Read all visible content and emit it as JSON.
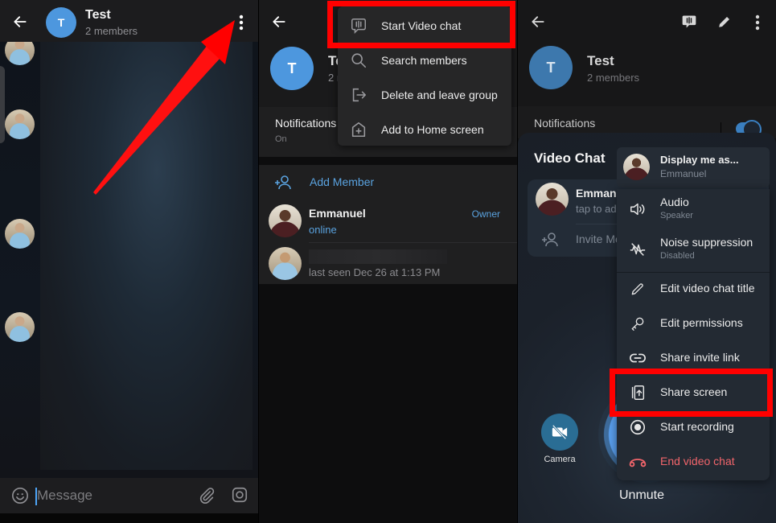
{
  "panel1": {
    "header": {
      "avatar_letter": "T",
      "title": "Test",
      "subtitle": "2 members"
    },
    "composer": {
      "placeholder": "Message"
    }
  },
  "panel2": {
    "header": {
      "avatar_letter": "T",
      "title": "Te",
      "subtitle": "2 m"
    },
    "menu": {
      "items": [
        {
          "icon": "video-chat-icon",
          "label": "Start Video chat",
          "highlighted": true
        },
        {
          "icon": "search-icon",
          "label": "Search members"
        },
        {
          "icon": "leave-icon",
          "label": "Delete and leave group"
        },
        {
          "icon": "add-home-icon",
          "label": "Add to Home screen"
        }
      ]
    },
    "notifications": {
      "label": "Notifications",
      "value": "On"
    },
    "members": {
      "add_label": "Add Member",
      "list": [
        {
          "name": "Emmanuel",
          "status": "online",
          "role": "Owner"
        },
        {
          "name": "",
          "status": "last seen Dec 26 at 1:13 PM",
          "role": ""
        }
      ]
    }
  },
  "panel3": {
    "header": {
      "avatar_letter": "T",
      "title": "Test",
      "subtitle": "2 members"
    },
    "notifications": {
      "label": "Notifications",
      "enabled": true
    },
    "video_chat": {
      "title": "Video Chat",
      "participant_name": "Emmanuel",
      "participant_sub": "tap to add",
      "invite_label": "Invite Members",
      "camera_label": "Camera",
      "unmute_label": "Unmute"
    },
    "menu": {
      "display": {
        "title": "Display me as...",
        "subtitle": "Emmanuel"
      },
      "items": [
        {
          "icon": "speaker-icon",
          "label": "Audio",
          "sub": "Speaker"
        },
        {
          "icon": "noise-suppression-icon",
          "label": "Noise suppression",
          "sub": "Disabled"
        },
        {
          "icon": "pencil-icon",
          "label": "Edit video chat title"
        },
        {
          "icon": "key-icon",
          "label": "Edit permissions"
        },
        {
          "icon": "link-icon",
          "label": "Share invite link"
        },
        {
          "icon": "share-screen-icon",
          "label": "Share screen",
          "highlighted": true
        },
        {
          "icon": "record-icon",
          "label": "Start recording"
        },
        {
          "icon": "end-call-icon",
          "label": "End video chat",
          "danger": true
        }
      ]
    }
  },
  "colors": {
    "accent": "#5aa3e0",
    "avatar": "#4d97de",
    "highlight": "#ff0000",
    "danger": "#f2656b",
    "toggle_on": "#3a7fc0"
  }
}
